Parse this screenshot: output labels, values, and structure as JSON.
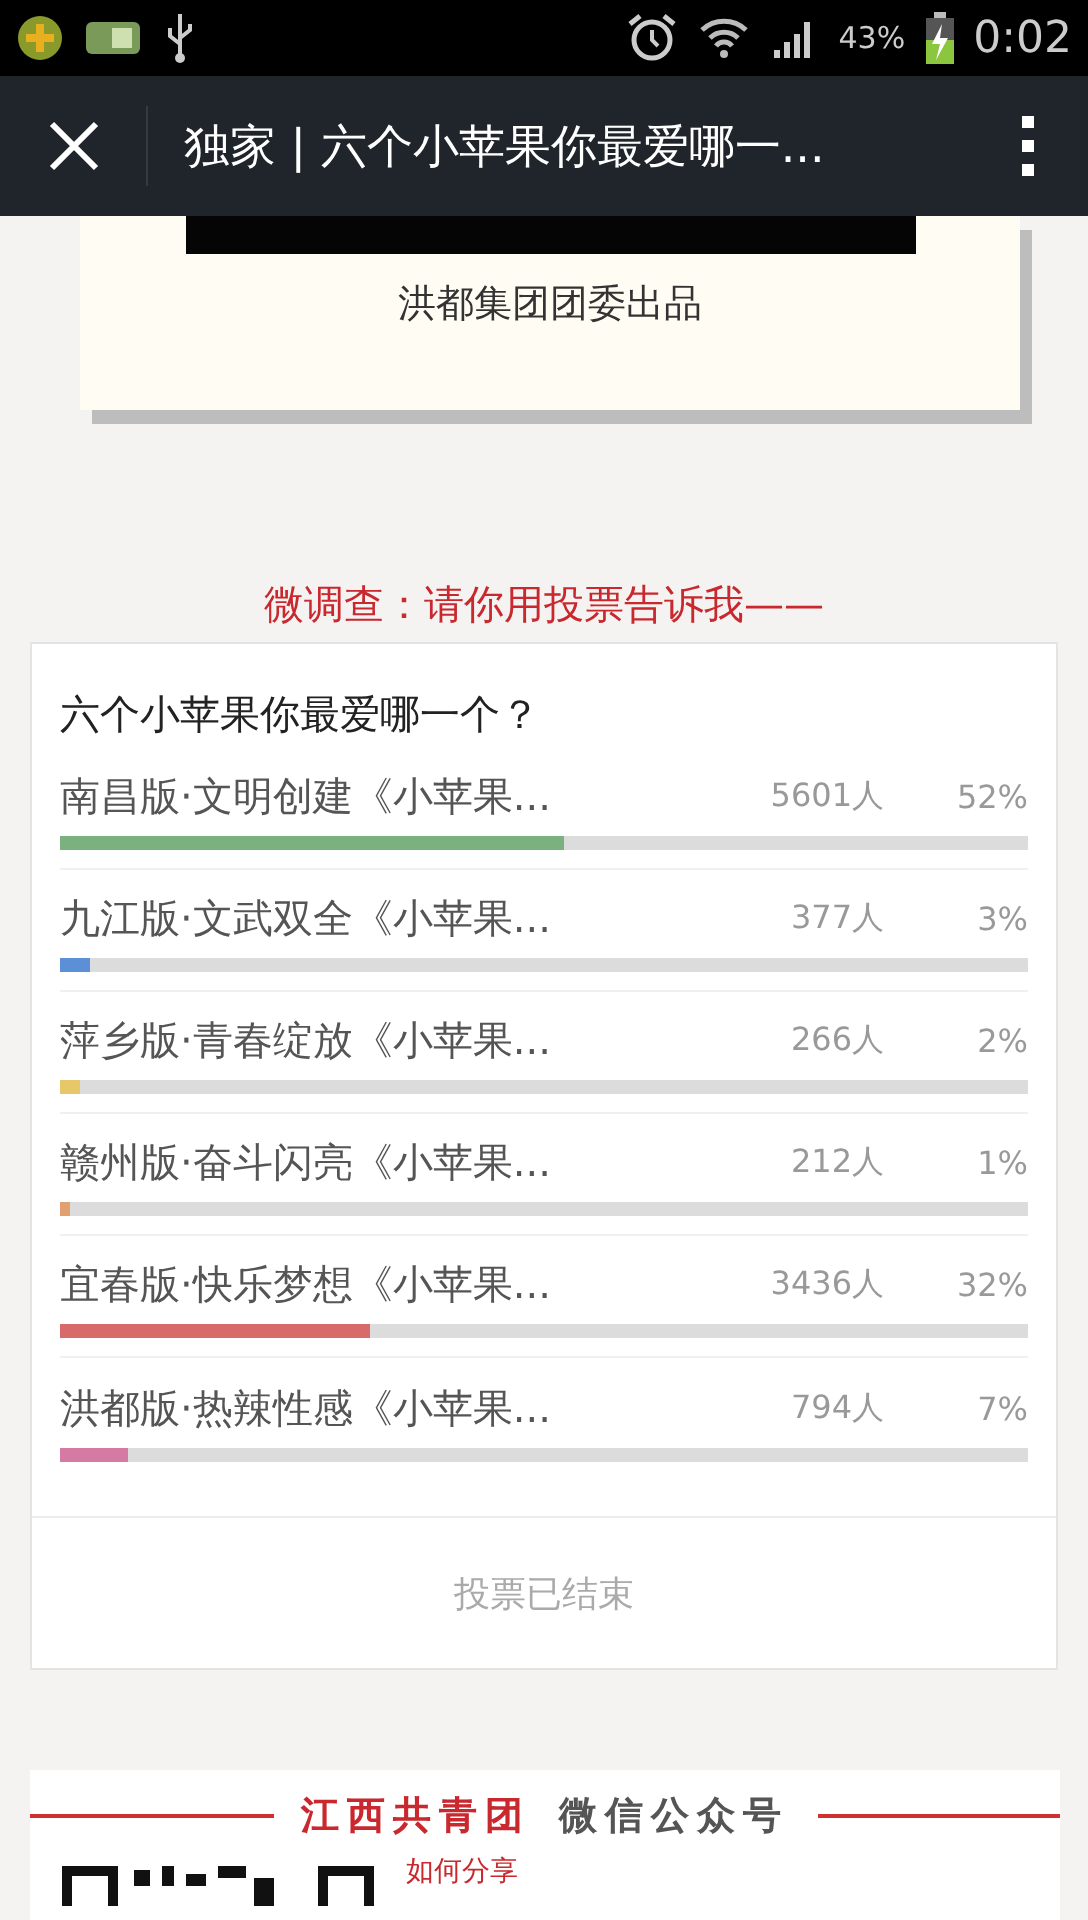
{
  "status_bar": {
    "battery_text": "43%",
    "time": "0:02"
  },
  "app_bar": {
    "title": "独家 | 六个小苹果你最爱哪一..."
  },
  "banner_card": {
    "caption": "洪都集团团委出品"
  },
  "survey_heading": "微调查：请你用投票告诉我——",
  "poll": {
    "question": "六个小苹果你最爱哪一个？",
    "options": [
      {
        "label": "南昌版·文明创建《小苹果...",
        "count": "5601人",
        "percent": "52%",
        "level": 0.52,
        "color": "#7bb07f"
      },
      {
        "label": "九江版·文武双全《小苹果...",
        "count": "377人",
        "percent": "3%",
        "level": 0.03,
        "color": "#5b8fd6"
      },
      {
        "label": "萍乡版·青春绽放《小苹果...",
        "count": "266人",
        "percent": "2%",
        "level": 0.02,
        "color": "#e8c66a"
      },
      {
        "label": "赣州版·奋斗闪亮《小苹果...",
        "count": "212人",
        "percent": "1%",
        "level": 0.01,
        "color": "#e0a070"
      },
      {
        "label": "宜春版·快乐梦想《小苹果...",
        "count": "3436人",
        "percent": "32%",
        "level": 0.32,
        "color": "#d86a6a"
      },
      {
        "label": "洪都版·热辣性感《小苹果...",
        "count": "794人",
        "percent": "7%",
        "level": 0.07,
        "color": "#d57aa3"
      }
    ],
    "footer": "投票已结束"
  },
  "account_card": {
    "title_red": "江西共青团",
    "title_dark": "微信公众号",
    "link": "如何分享"
  }
}
